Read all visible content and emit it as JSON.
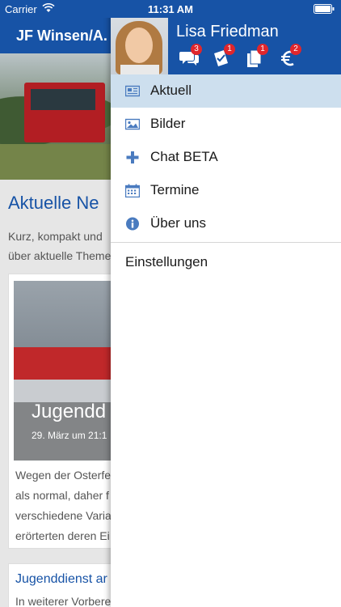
{
  "status_bar": {
    "carrier": "Carrier",
    "time": "11:31 AM"
  },
  "background_page": {
    "header_title": "JF Winsen/A.",
    "section_title": "Aktuelle Ne",
    "intro_lines": [
      "Kurz, kompakt und",
      "über aktuelle Theme"
    ],
    "card": {
      "title": "Jugendd",
      "date": "29. März um 21:1",
      "text_lines": [
        "Wegen der Osterfe",
        "als normal, daher f",
        "verschiedene Varia",
        "erörterten deren Ei"
      ]
    },
    "card2": {
      "title": "Jugenddienst ar",
      "text": "In weiterer Vorbere"
    }
  },
  "drawer": {
    "user_name": "Lisa Friedman",
    "header_icons": [
      {
        "icon": "chat-bubbles-icon",
        "badge": "3"
      },
      {
        "icon": "tasks-icon",
        "badge": "1"
      },
      {
        "icon": "documents-icon",
        "badge": "1"
      },
      {
        "icon": "euro-icon",
        "badge": "2"
      }
    ],
    "menu": [
      {
        "label": "Aktuell",
        "icon": "newspaper-icon",
        "active": true
      },
      {
        "label": "Bilder",
        "icon": "image-icon",
        "active": false
      },
      {
        "label": "Chat BETA",
        "icon": "plus-icon",
        "active": false
      },
      {
        "label": "Termine",
        "icon": "calendar-icon",
        "active": false
      },
      {
        "label": "Über uns",
        "icon": "info-icon",
        "active": false
      }
    ],
    "settings_label": "Einstellungen"
  },
  "colors": {
    "brand_blue": "#1753a6",
    "active_row": "#cddfee",
    "badge_red": "#e0262c",
    "icon_blue": "#4a7bbf"
  }
}
